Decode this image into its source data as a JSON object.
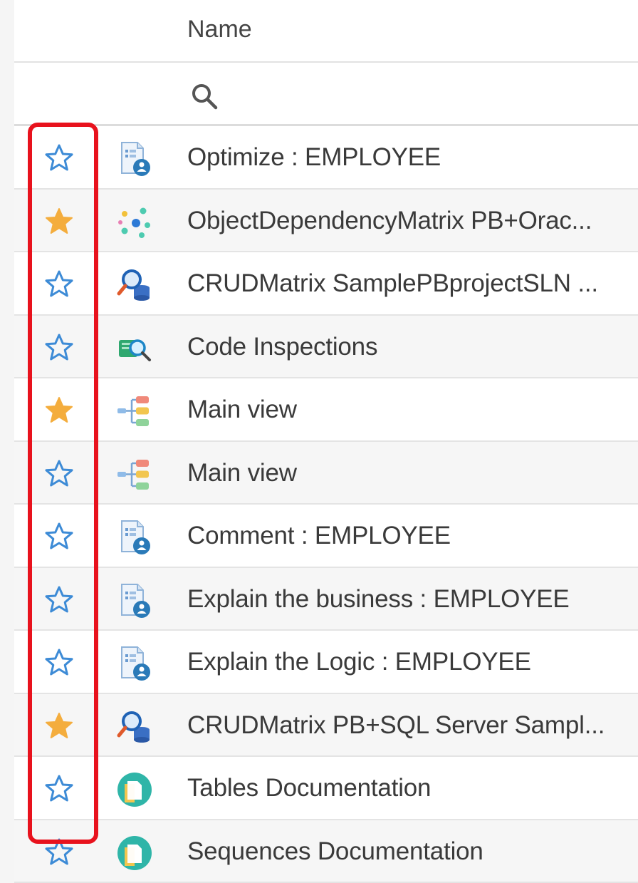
{
  "table": {
    "header": {
      "name_label": "Name"
    },
    "filter": {
      "search_icon": "search-icon"
    },
    "colors": {
      "star_filled": "#f4ad3d",
      "star_outline": "#3d8bd6",
      "highlight": "#e8121d"
    },
    "rows": [
      {
        "name": "Optimize : EMPLOYEE",
        "favorite": false,
        "icon": "document-user-icon"
      },
      {
        "name": "ObjectDependencyMatrix PB+Orac...",
        "favorite": true,
        "icon": "dependency-matrix-icon"
      },
      {
        "name": "CRUDMatrix SamplePBprojectSLN ...",
        "favorite": false,
        "icon": "crud-matrix-icon"
      },
      {
        "name": "Code Inspections",
        "favorite": false,
        "icon": "code-inspection-icon"
      },
      {
        "name": "Main view",
        "favorite": true,
        "icon": "tree-view-icon"
      },
      {
        "name": "Main view",
        "favorite": false,
        "icon": "tree-view-icon"
      },
      {
        "name": "Comment : EMPLOYEE",
        "favorite": false,
        "icon": "document-user-icon"
      },
      {
        "name": "Explain the business : EMPLOYEE",
        "favorite": false,
        "icon": "document-user-icon"
      },
      {
        "name": "Explain the Logic : EMPLOYEE",
        "favorite": false,
        "icon": "document-user-icon"
      },
      {
        "name": "CRUDMatrix PB+SQL Server Sampl...",
        "favorite": true,
        "icon": "crud-matrix-icon"
      },
      {
        "name": "Tables Documentation",
        "favorite": false,
        "icon": "documentation-icon"
      },
      {
        "name": "Sequences Documentation",
        "favorite": false,
        "icon": "documentation-icon"
      }
    ]
  }
}
